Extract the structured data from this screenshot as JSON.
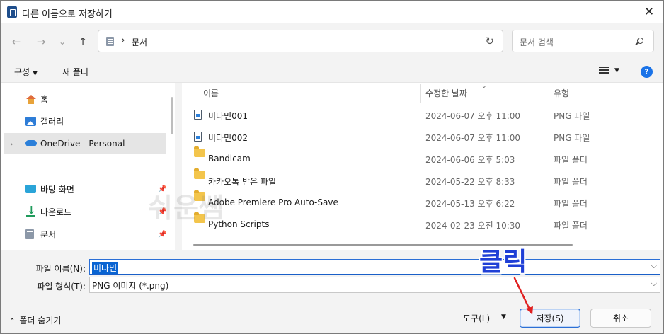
{
  "window": {
    "title": "다른 이름으로 저장하기",
    "close_glyph": "✕"
  },
  "nav": {
    "back_glyph": "←",
    "forward_glyph": "→",
    "recent_glyph": "⌄",
    "up_glyph": "↑",
    "address_sep": "›",
    "address_path": "문서",
    "refresh_glyph": "↻",
    "search_placeholder": "문서 검색"
  },
  "toolbar": {
    "organize_label": "구성",
    "organize_caret": "▼",
    "new_folder_label": "새 폴더",
    "view_caret": "▼",
    "help_glyph": "?"
  },
  "sidebar": {
    "items": [
      {
        "label": "홈",
        "icon": "home-icon"
      },
      {
        "label": "갤러리",
        "icon": "gallery-icon"
      },
      {
        "label": "OneDrive - Personal",
        "icon": "cloud-icon",
        "chevron": "›",
        "selected": true
      },
      {
        "label": "바탕 화면",
        "icon": "desktop-icon",
        "pin": "📌"
      },
      {
        "label": "다운로드",
        "icon": "download-icon",
        "pin": "📌"
      },
      {
        "label": "문서",
        "icon": "docs-icon",
        "pin": "📌"
      }
    ]
  },
  "filelist": {
    "columns": {
      "name": "이름",
      "date": "수정한 날짜",
      "type": "유형",
      "sort_glyph": "⌄"
    },
    "rows": [
      {
        "name": "비타민001",
        "date": "2024-06-07 오후 11:00",
        "type": "PNG 파일",
        "icon": "png-file-icon"
      },
      {
        "name": "비타민002",
        "date": "2024-06-07 오후 11:00",
        "type": "PNG 파일",
        "icon": "png-file-icon"
      },
      {
        "name": "Bandicam",
        "date": "2024-06-06 오후 5:03",
        "type": "파일 폴더",
        "icon": "folder-icon"
      },
      {
        "name": "카카오톡 받은 파일",
        "date": "2024-05-22 오후 8:33",
        "type": "파일 폴더",
        "icon": "folder-icon"
      },
      {
        "name": "Adobe Premiere Pro Auto-Save",
        "date": "2024-05-13 오후 6:22",
        "type": "파일 폴더",
        "icon": "folder-icon"
      },
      {
        "name": "Python Scripts",
        "date": "2024-02-23 오전 10:30",
        "type": "파일 폴더",
        "icon": "folder-icon"
      }
    ]
  },
  "watermark": "쉬운쌤",
  "form": {
    "filename_label": "파일 이름(N):",
    "filename_value": "비타민",
    "filetype_label": "파일 형식(T):",
    "filetype_value": "PNG 이미지 (*.png)",
    "dropdown_glyph": "⌵",
    "hide_folders_glyph": "⌃",
    "hide_folders_label": "폴더 숨기기",
    "tools_label": "도구(L)",
    "tools_caret": "▼",
    "save_label": "저장(S)",
    "cancel_label": "취소"
  },
  "annotation": {
    "text": "클릭",
    "color": "#1f3fd6",
    "arrow_color": "#e02020"
  }
}
